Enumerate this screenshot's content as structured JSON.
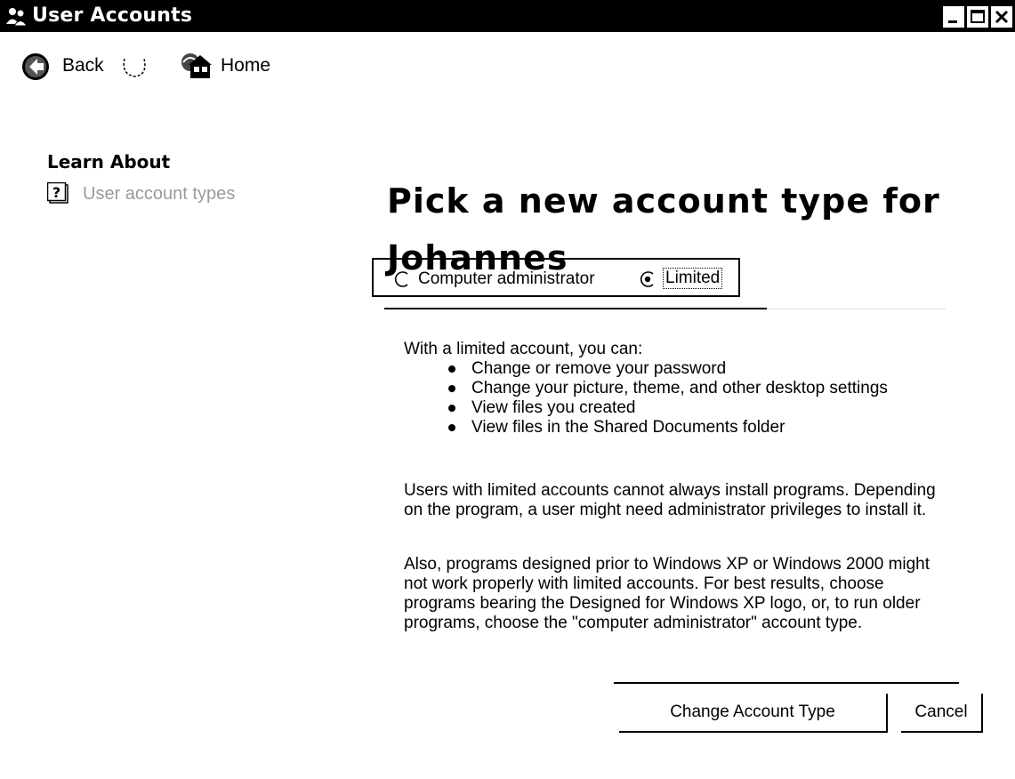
{
  "window": {
    "title": "User Accounts",
    "controls": [
      "minimize",
      "maximize",
      "close"
    ]
  },
  "toolbar": {
    "back_label": "Back",
    "home_label": "Home"
  },
  "sidebar": {
    "section_title": "Learn About",
    "items": [
      {
        "label": "User account types",
        "icon": "help-icon"
      }
    ]
  },
  "main": {
    "heading_line1": "Pick a new account type for",
    "heading_line2": "Johannes",
    "account_types": [
      {
        "label": "Computer administrator",
        "selected": false
      },
      {
        "label": "Limited",
        "selected": true
      }
    ],
    "intro": "With a limited account, you can:",
    "bullets": [
      "Change or remove your password",
      "Change your picture, theme, and other desktop settings",
      "View files you created",
      "View files in the Shared Documents folder"
    ],
    "paragraph1": "Users with limited accounts cannot always install programs. Depending on the program, a user might need administrator privileges to install it.",
    "paragraph2": "Also, programs designed prior to Windows XP or Windows 2000 might not work properly with limited accounts. For best results, choose programs bearing the Designed for Windows XP logo, or, to run older programs, choose the \"computer administrator\" account type."
  },
  "buttons": {
    "change_label": "Change Account Type",
    "cancel_label": "Cancel"
  }
}
